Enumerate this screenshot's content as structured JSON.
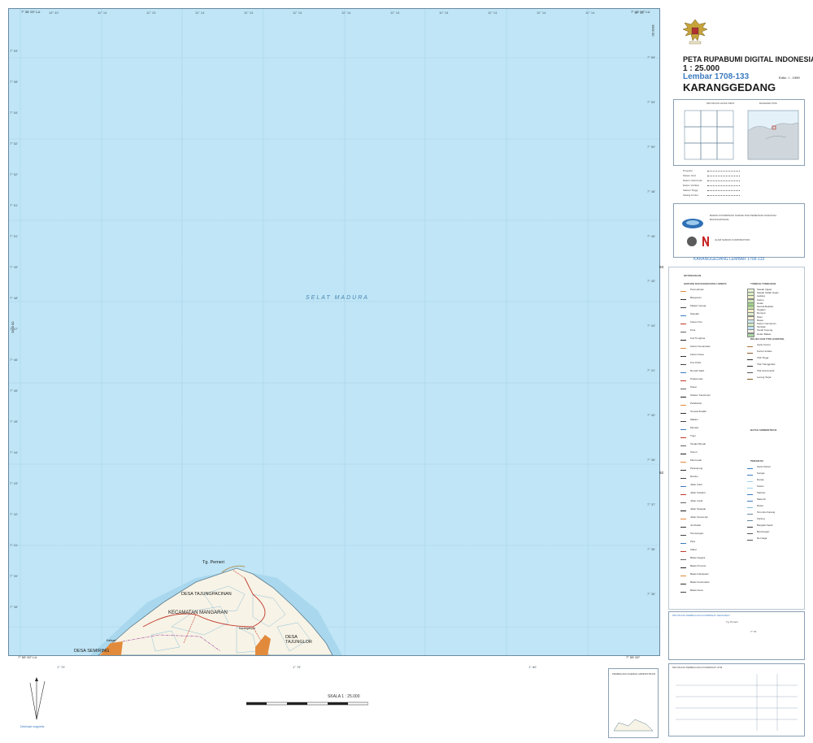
{
  "map": {
    "sea_name": "SELAT MADURA",
    "places": {
      "tg_pemeri": "Tg. Pemeri",
      "desa_tajungpacinan": "DESA TAJUNGPACINAN",
      "kecamatan": "KECAMATAN MANGARAN",
      "desa_semiring": "DESA SEMIRING",
      "desa_tajunglor": "DESA TAJUNGLOR",
      "kalisari": "Kalisari",
      "karanganyar": "Karanganyar"
    },
    "corner_top_left": "7° 36' 00\" LU",
    "corner_top_right": "7° 40' 00\" LU",
    "corner_bottom_left": "7° 59' 00\" LU",
    "corner_bottom_right": "7° 59' 00\"",
    "side_label_left": "1900 00",
    "side_label_right": "1900 00",
    "top_ticks": [
      "14° 40'",
      "11° 14",
      "11° 13",
      "11° 14",
      "11° 14",
      "11° 14",
      "11° 14",
      "11° 14",
      "11° 14",
      "11° 14",
      "11° 14",
      "11° 14",
      "11° 13"
    ],
    "left_ticks": [
      "7° 53'",
      "7° 58'",
      "7° 54'",
      "7° 52'",
      "7° 52'",
      "7° 51'",
      "7° 51'",
      "7° 49'",
      "7° 48'",
      "7° 47'",
      "7° 46'",
      "7° 45'",
      "7° 45'",
      "7° 44'",
      "7° 43'",
      "7° 42'",
      "7° 41'",
      "7° 39'",
      "7° 38'"
    ],
    "right_ticks": [
      "7° 55'",
      "7° 53'",
      "7° 50'",
      "7° 48'",
      "7° 46'",
      "7° 45'",
      "7° 43'",
      "7° 41'",
      "7° 40'",
      "7° 38'",
      "7° 37'",
      "7° 36'",
      "7° 35'"
    ],
    "right_grid_marks": [
      "93",
      "92"
    ],
    "bottom_ticks": [
      "1° 70'",
      "1° 75'",
      "1° 80'"
    ]
  },
  "header": {
    "line1": "PETA RUPABUMI DIGITAL INDONESIA",
    "scale": "1 : 25.000",
    "sheet": "Lembar 1708-133",
    "name": "KARANGGEDANG",
    "edition": "Edisi : I - 1999",
    "sheet_footer": "KARANGGEDANG LEMBAR 1708-133",
    "index_label": "PETUNJUK LETAK PETA",
    "region_label": "DIAGRAM TATA"
  },
  "legend": {
    "heading": "KETERANGAN",
    "left_col_heading": "GEDUNG DAN BANGUNAN LAINNYA",
    "right_col_heading": "TUMBUH-TUMBUHAN",
    "left_items": [
      "Permukiman",
      "Bangunan",
      "Masjid, Gereja",
      "Sekolah",
      "Kantor Pos",
      "Pura",
      "Kuil Tionghoa",
      "Kantor Kecamatan",
      "Kantor Desa",
      "Pos Polisi",
      "Rumah Sakit",
      "Puskesmas",
      "Pasar",
      "Stasiun Kereta Api",
      "Pelabuhan",
      "Tempat Ibadah",
      "Makam",
      "Menara",
      "Tugu",
      "Tangki Minyak",
      "Sumur",
      "Mercusuar",
      "Pelampung",
      "Rambu",
      "Jalan Arteri",
      "Jalan Kolektor",
      "Jalan Lokal",
      "Jalan Setapak",
      "Jalan Kereta Api",
      "Jembatan",
      "Terowongan",
      "Pipa",
      "Kabel",
      "Batas Negara",
      "Batas Provinsi",
      "Batas Kabupaten",
      "Batas Kecamatan",
      "Batas Desa"
    ],
    "right_items": [
      "Sawah Irigasi",
      "Sawah Tadah Hujan",
      "Ladang",
      "Kebun",
      "Hutan",
      "Semak Belukar",
      "Tegalan",
      "Rumput",
      "Pasir",
      "Rawa",
      "Kebun Campuran",
      "Tambak",
      "Tanah Kosong",
      "Hutan Bakau"
    ],
    "relief_heading": "RELIEF DAN TITIK KONTROL",
    "admin_heading": "BATAS ADMINISTRASI",
    "water_heading": "PERAIRAN",
    "relief_items": [
      "Garis Kontur",
      "Kontur Indeks",
      "Titik Tinggi",
      "Titik Trianggulasi",
      "Titik Gravimetrik",
      "Lereng Terjal"
    ],
    "water_items": [
      "Garis Pantai",
      "Sungai",
      "Danau",
      "Kolam",
      "Saluran",
      "Mata Air",
      "Rawa",
      "Terumbu Karang",
      "Karang",
      "Bangkai Kapal",
      "Bendungan",
      "Dermaga"
    ]
  },
  "info_block": [
    "Proyeksi",
    "Sistem Grid",
    "Datum Horizontal",
    "Datum Vertikal",
    "Satuan Tinggi",
    "Selang Kontur"
  ],
  "agency": {
    "name1": "BADAN KOORDINASI SURVEI DAN PEMETAAN NASIONAL",
    "name2": "BAKOSURTANAL",
    "name3": "ALAM SARGIS CORPORATION"
  },
  "bottom": {
    "scale_label": "SKALA 1 : 25.000",
    "declination": "Deklinasi magnetis",
    "index_admin": "PEMBAGIAN DAERAH ADMINISTRASI",
    "utm_heading": "PETUNJUK PEMBACAAN KOORDINAT UTM",
    "geo_heading": "PETUNJUK PEMBACAAN KOORDINAT GEOGRAFI",
    "example_1": "7° 70'",
    "example_2": "Tg. Pemeri"
  }
}
